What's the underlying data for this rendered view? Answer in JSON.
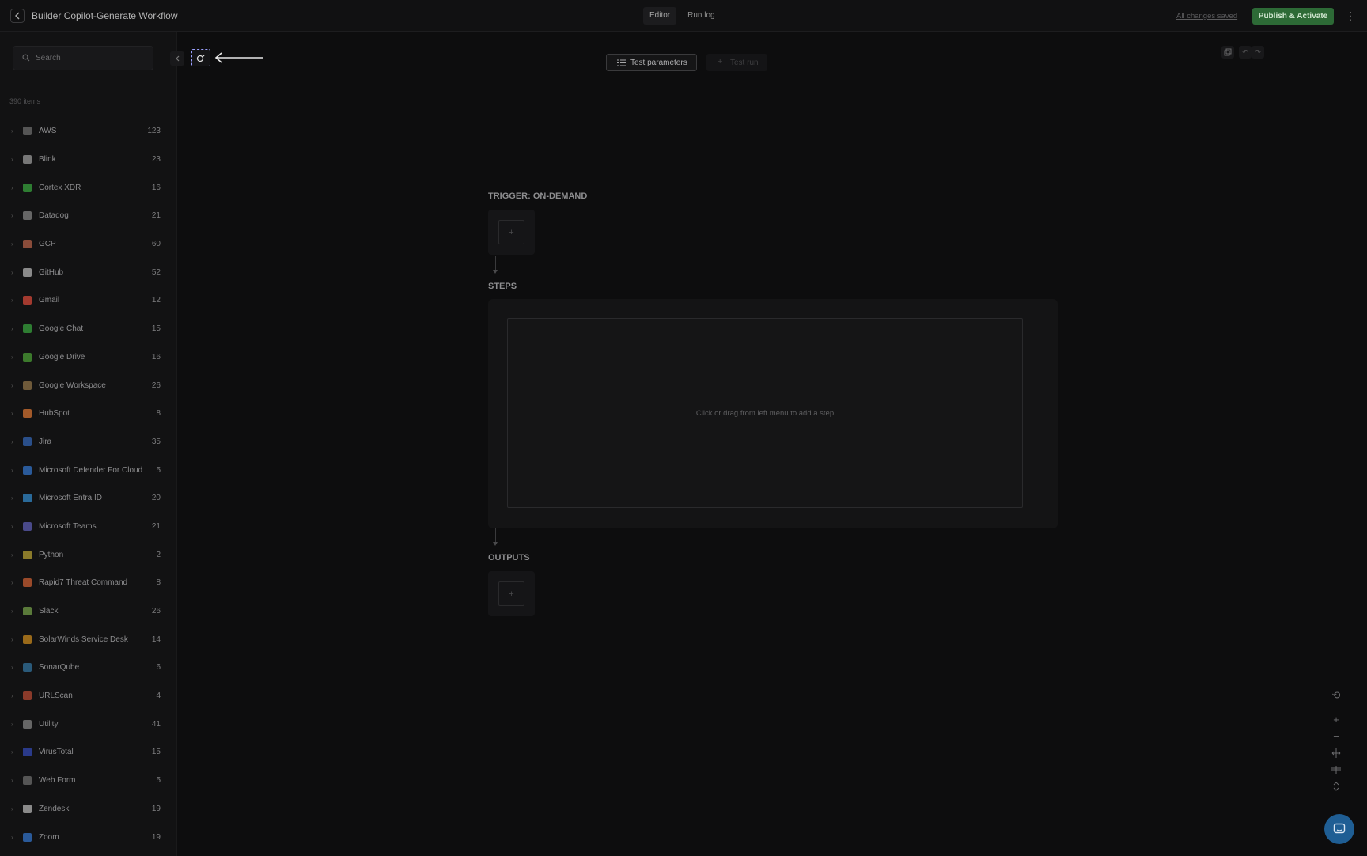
{
  "header": {
    "title": "Builder Copilot-Generate Workflow",
    "tabs": [
      {
        "label": "Editor",
        "active": true
      },
      {
        "label": "Run log",
        "active": false
      }
    ],
    "saved_status": "All changes saved",
    "publish_label": "Publish & Activate",
    "more_icon": "more-vertical-icon",
    "back_icon": "chevron-left-icon"
  },
  "sidebar": {
    "search_placeholder": "Search",
    "items_count": "390 items",
    "items": [
      {
        "label": "AWS",
        "count": "123",
        "icon": "aws-icon",
        "color": "#555555"
      },
      {
        "label": "Blink",
        "count": "23",
        "icon": "blink-icon",
        "color": "#777777"
      },
      {
        "label": "Cortex XDR",
        "count": "16",
        "icon": "cortex-xdr-icon",
        "color": "#2e7d32"
      },
      {
        "label": "Datadog",
        "count": "21",
        "icon": "datadog-icon",
        "color": "#666666"
      },
      {
        "label": "GCP",
        "count": "60",
        "icon": "gcp-icon",
        "color": "#8a4c3a"
      },
      {
        "label": "GitHub",
        "count": "52",
        "icon": "github-icon",
        "color": "#8a8a8a"
      },
      {
        "label": "Gmail",
        "count": "12",
        "icon": "gmail-icon",
        "color": "#a33a2f"
      },
      {
        "label": "Google Chat",
        "count": "15",
        "icon": "google-chat-icon",
        "color": "#2e7d32"
      },
      {
        "label": "Google Drive",
        "count": "16",
        "icon": "google-drive-icon",
        "color": "#3c7a2c"
      },
      {
        "label": "Google Workspace",
        "count": "26",
        "icon": "google-workspace-icon",
        "color": "#6f5a3a"
      },
      {
        "label": "HubSpot",
        "count": "8",
        "icon": "hubspot-icon",
        "color": "#a35a2a"
      },
      {
        "label": "Jira",
        "count": "35",
        "icon": "jira-icon",
        "color": "#2a4f8a"
      },
      {
        "label": "Microsoft Defender For Cloud",
        "count": "5",
        "icon": "microsoft-defender-icon",
        "color": "#2a5a9a"
      },
      {
        "label": "Microsoft Entra ID",
        "count": "20",
        "icon": "microsoft-entra-icon",
        "color": "#2a6a9a"
      },
      {
        "label": "Microsoft Teams",
        "count": "21",
        "icon": "microsoft-teams-icon",
        "color": "#4a4a8a"
      },
      {
        "label": "Python",
        "count": "2",
        "icon": "python-icon",
        "color": "#8a7a2a"
      },
      {
        "label": "Rapid7 Threat Command",
        "count": "8",
        "icon": "rapid7-icon",
        "color": "#9a4a2a"
      },
      {
        "label": "Slack",
        "count": "26",
        "icon": "slack-icon",
        "color": "#5a7a3a"
      },
      {
        "label": "SolarWinds Service Desk",
        "count": "14",
        "icon": "solarwinds-icon",
        "color": "#9a6a1a"
      },
      {
        "label": "SonarQube",
        "count": "6",
        "icon": "sonarqube-icon",
        "color": "#2a5a7a"
      },
      {
        "label": "URLScan",
        "count": "4",
        "icon": "urlscan-icon",
        "color": "#8a3a2a"
      },
      {
        "label": "Utility",
        "count": "41",
        "icon": "utility-icon",
        "color": "#666666"
      },
      {
        "label": "VirusTotal",
        "count": "15",
        "icon": "virustotal-icon",
        "color": "#2a3a8a"
      },
      {
        "label": "Web Form",
        "count": "5",
        "icon": "web-form-icon",
        "color": "#555555"
      },
      {
        "label": "Zendesk",
        "count": "19",
        "icon": "zendesk-icon",
        "color": "#8a8a8a"
      },
      {
        "label": "Zoom",
        "count": "19",
        "icon": "zoom-icon",
        "color": "#2a5a9a"
      }
    ]
  },
  "canvas": {
    "test_parameters_label": "Test parameters",
    "test_run_label": "Test run",
    "trigger_label": "TRIGGER: ON-DEMAND",
    "steps_label": "STEPS",
    "outputs_label": "OUTPUTS",
    "steps_placeholder": "Click or drag from left menu to add a step",
    "add_symbol": "+"
  },
  "colors": {
    "accent": "#2d6a36",
    "chat": "#1f5e94",
    "highlight": "#9aa0ff"
  }
}
